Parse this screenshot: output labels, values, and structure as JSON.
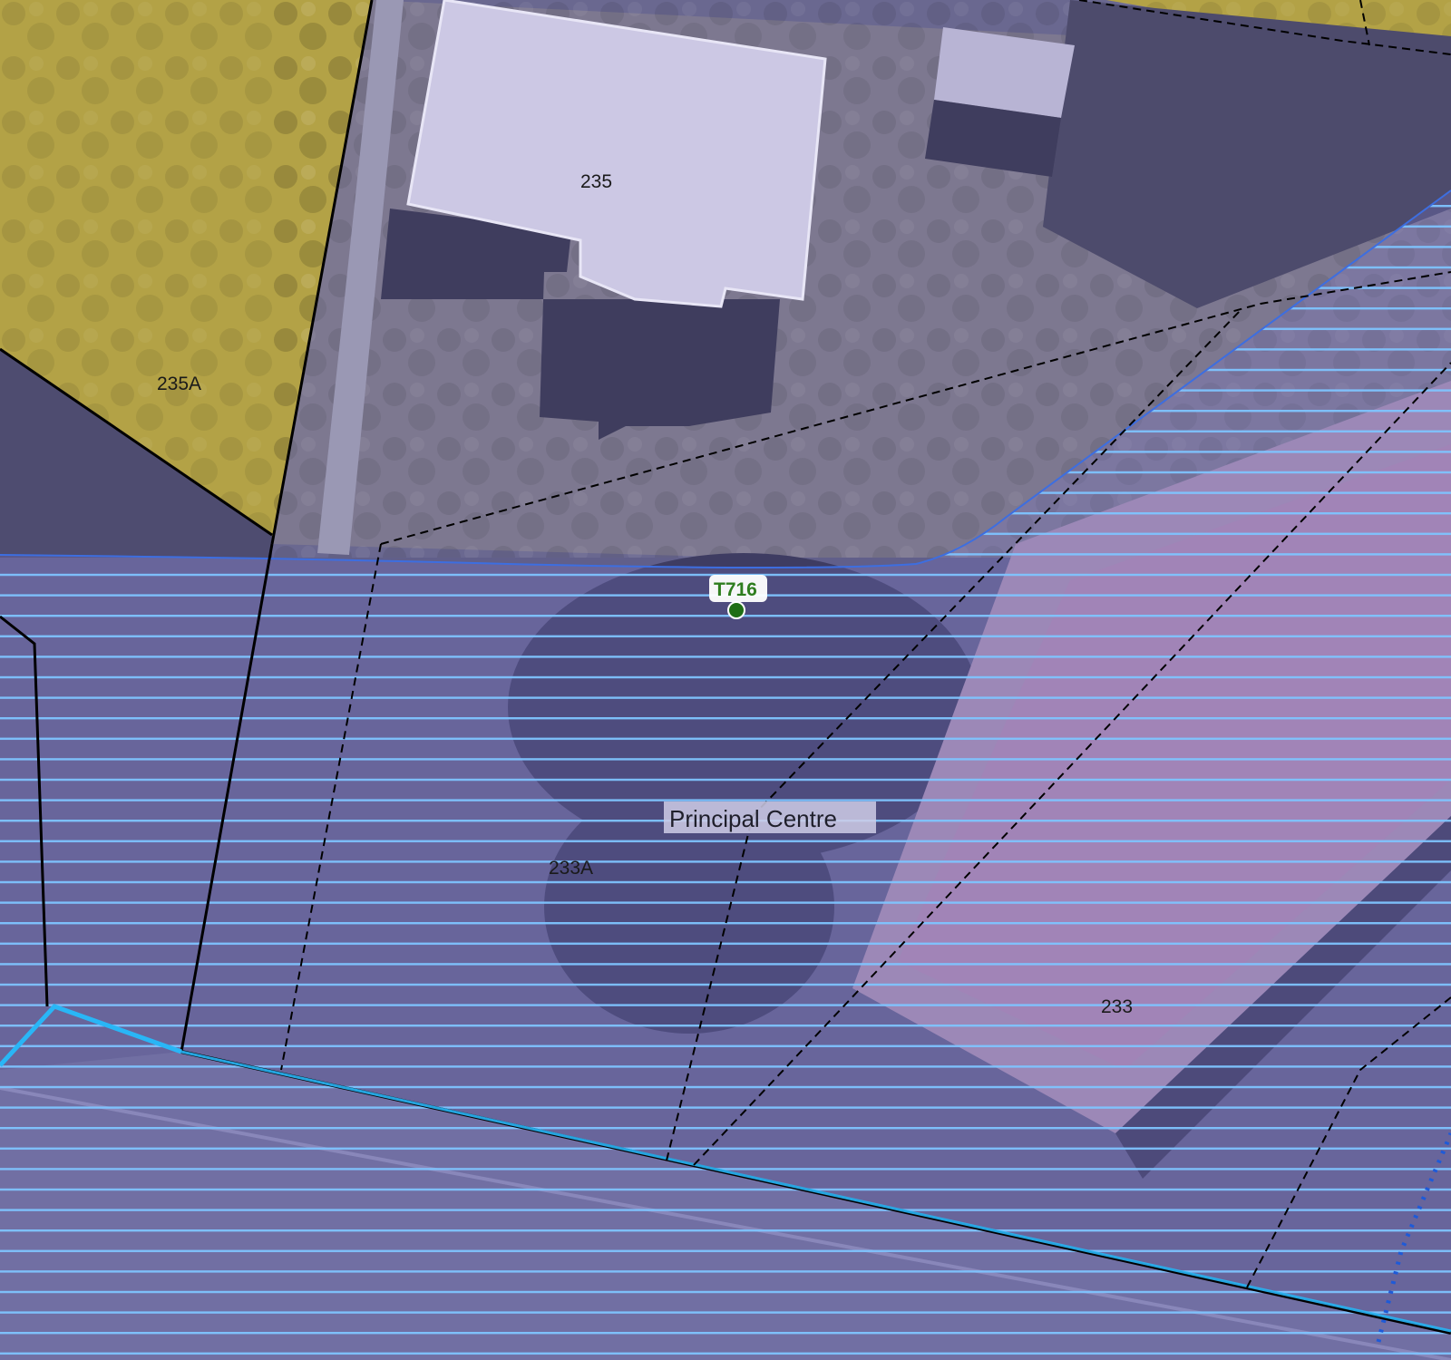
{
  "map": {
    "parcels": [
      {
        "id": "235A",
        "label": "235A"
      },
      {
        "id": "235",
        "label": "235"
      },
      {
        "id": "233A",
        "label": "233A"
      },
      {
        "id": "233",
        "label": "233"
      }
    ],
    "zone": {
      "label": "Principal Centre",
      "hatch_color": "#63b4ff",
      "tint_color": "#7b78c8"
    },
    "tree_marker": {
      "label": "T716",
      "color": "#2e7d1e"
    },
    "colors": {
      "yellow_zone": "#b9a642",
      "purple_overlay": "#7472b0",
      "boundary": "#000000",
      "road_line": "#29b6f6"
    }
  }
}
